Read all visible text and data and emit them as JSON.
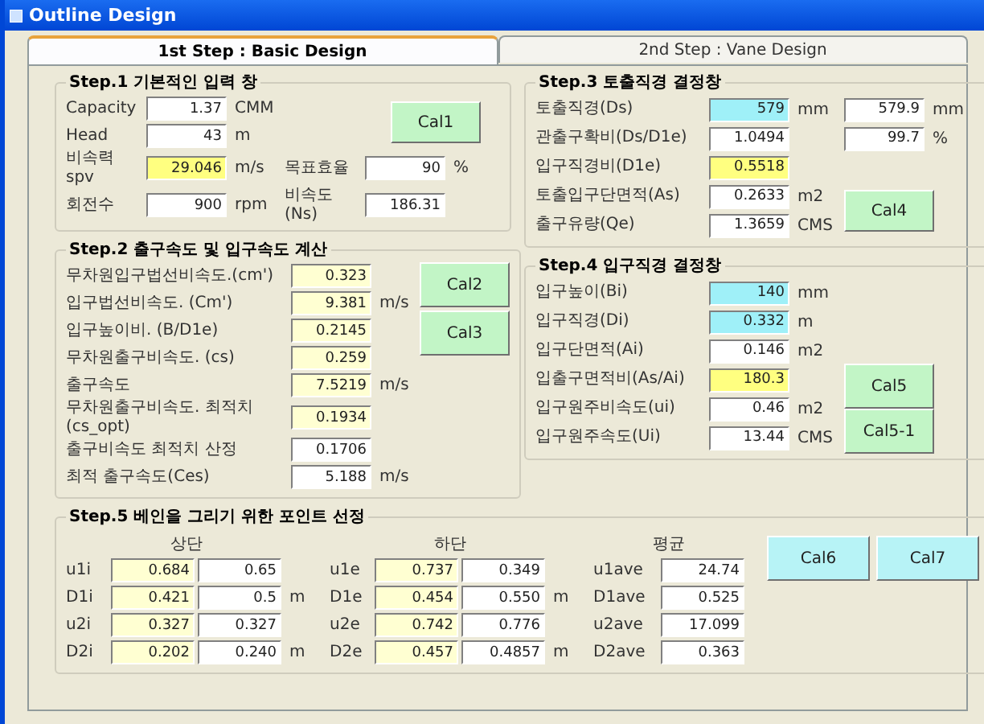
{
  "window": {
    "title": "Outline Design"
  },
  "tabs": [
    {
      "label": "1st Step : Basic Design",
      "selected": true
    },
    {
      "label": "2nd Step : Vane Design",
      "selected": false
    }
  ],
  "step1": {
    "title": "Step.1 기본적인 입력 창",
    "rows": [
      {
        "label": "Capacity",
        "value": "1.37",
        "unit": "CMM",
        "kind": "input"
      },
      {
        "label": "Head",
        "value": "43",
        "unit": "m",
        "kind": "input"
      },
      {
        "label": "비속력 spv",
        "value": "29.046",
        "unit": "m/s",
        "kind": "highlighted"
      },
      {
        "label": "회전수",
        "value": "900",
        "unit": "rpm",
        "kind": "input"
      }
    ],
    "extra": [
      {
        "label": "목표효율",
        "value": "90",
        "unit": "%",
        "kind": "input"
      },
      {
        "label": "비속도 (Ns)",
        "value": "186.31",
        "kind": "input"
      }
    ],
    "button": "Cal1"
  },
  "step2": {
    "title": "Step.2 출구속도 및 입구속도 계산",
    "rows": [
      {
        "label": "무차원입구법선비속도.(cm')",
        "value": "0.323",
        "kind": "computed"
      },
      {
        "label": "입구법선비속도. (Cm')",
        "value": "9.381",
        "unit": "m/s",
        "kind": "computed"
      },
      {
        "label": "입구높이비. (B/D1e)",
        "value": "0.2145",
        "kind": "computed"
      },
      {
        "label": "무차원출구비속도. (cs)",
        "value": "0.259",
        "kind": "computed"
      },
      {
        "label": "출구속도",
        "value": "7.5219",
        "unit": "m/s",
        "kind": "computed"
      },
      {
        "label": "무차원출구비속도. 최적치 (cs_opt)",
        "value": "0.1934",
        "kind": "computed"
      },
      {
        "label": "출구비속도 최적치 산정",
        "value": "0.1706",
        "kind": "input"
      },
      {
        "label": "최적 출구속도(Ces)",
        "value": "5.188",
        "unit": "m/s",
        "kind": "input"
      }
    ],
    "buttons": [
      "Cal2",
      "Cal3"
    ]
  },
  "step3": {
    "title": "Step.3 토출직경 결정창",
    "rows": [
      {
        "label": "토출직경(Ds)",
        "value": "579",
        "unit": "mm",
        "kind": "dimension",
        "extra": {
          "value": "579.9",
          "unit": "mm",
          "kind": "input"
        }
      },
      {
        "label": "관출구확비(Ds/D1e)",
        "value": "1.0494",
        "kind": "input",
        "extra": {
          "value": "99.7",
          "unit": "%",
          "kind": "input"
        }
      },
      {
        "label": "입구직경비(D1e)",
        "value": "0.5518",
        "kind": "highlighted"
      },
      {
        "label": "토출입구단면적(As)",
        "value": "0.2633",
        "unit": "m2",
        "kind": "input"
      },
      {
        "label": "출구유량(Qe)",
        "value": "1.3659",
        "unit": "CMS",
        "kind": "input"
      }
    ],
    "button": "Cal4"
  },
  "step4": {
    "title": "Step.4 입구직경 결정창",
    "rows": [
      {
        "label": "입구높이(Bi)",
        "value": "140",
        "unit": "mm",
        "kind": "dimension"
      },
      {
        "label": "입구직경(Di)",
        "value": "0.332",
        "unit": "m",
        "kind": "dimension"
      },
      {
        "label": "입구단면적(Ai)",
        "value": "0.146",
        "unit": "m2",
        "kind": "input"
      },
      {
        "label": "입출구면적비(As/Ai)",
        "value": "180.3",
        "kind": "highlighted"
      },
      {
        "label": "입구원주비속도(ui)",
        "value": "0.46",
        "unit": "m2",
        "kind": "input"
      },
      {
        "label": "입구원주속도(Ui)",
        "value": "13.44",
        "unit": "CMS",
        "kind": "input"
      }
    ],
    "buttons": [
      "Cal5",
      "Cal5-1"
    ]
  },
  "step5": {
    "title": "Step.5 베인을 그리기 위한 포인트 선정",
    "upper": {
      "header": "상단",
      "rows": [
        {
          "label": "u1i",
          "values": [
            "0.684",
            "0.65"
          ]
        },
        {
          "label": "D1i",
          "values": [
            "0.421",
            "0.5"
          ],
          "unit": "m"
        },
        {
          "label": "u2i",
          "values": [
            "0.327",
            "0.327"
          ]
        },
        {
          "label": "D2i",
          "values": [
            "0.202",
            "0.240"
          ],
          "unit": "m"
        }
      ]
    },
    "lower": {
      "header": "하단",
      "rows": [
        {
          "label": "u1e",
          "values": [
            "0.737",
            "0.349"
          ]
        },
        {
          "label": "D1e",
          "values": [
            "0.454",
            "0.550"
          ],
          "unit": "m"
        },
        {
          "label": "u2e",
          "values": [
            "0.742",
            "0.776"
          ]
        },
        {
          "label": "D2e",
          "values": [
            "0.457",
            "0.4857"
          ],
          "unit": "m"
        }
      ]
    },
    "average": {
      "header": "평균",
      "rows": [
        {
          "label": "u1ave",
          "value": "24.74"
        },
        {
          "label": "D1ave",
          "value": "0.525"
        },
        {
          "label": "u2ave",
          "value": "17.099"
        },
        {
          "label": "D2ave",
          "value": "0.363"
        }
      ]
    },
    "buttons": [
      "Cal6",
      "Cal7"
    ]
  }
}
